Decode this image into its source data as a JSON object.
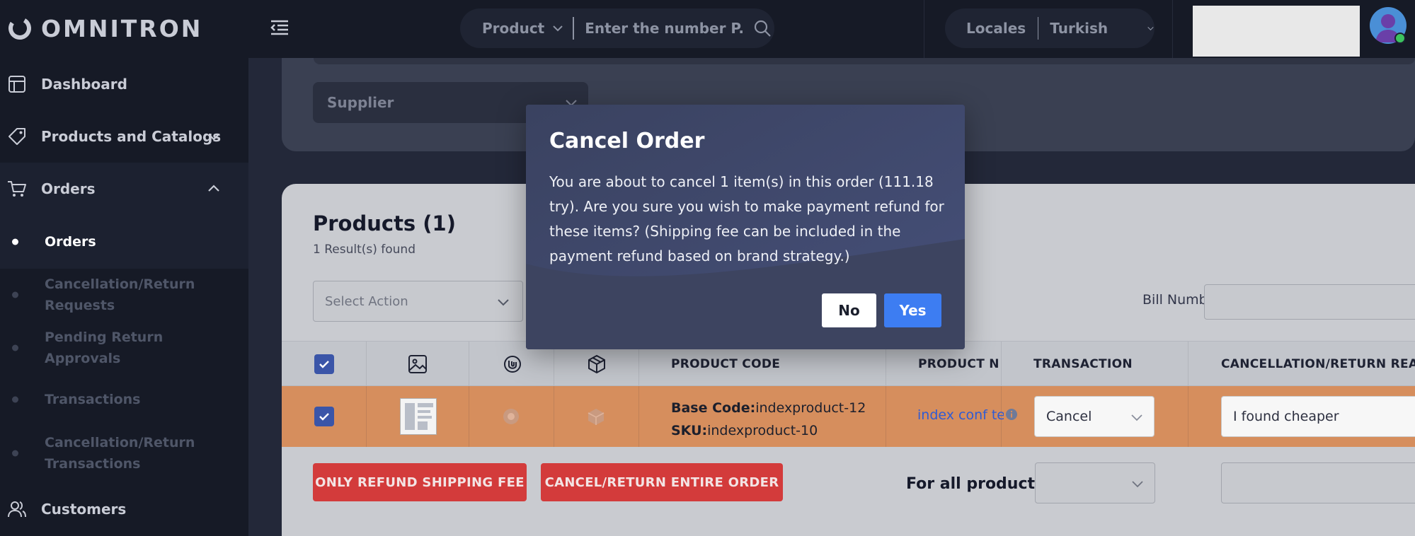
{
  "app": {
    "logo_text": "OMNITRON"
  },
  "sidebar": {
    "items": [
      {
        "label": "Dashboard",
        "icon": "layout-icon"
      },
      {
        "label": "Products and Catalogs",
        "icon": "tag-icon",
        "expanded": false
      },
      {
        "label": "Orders",
        "icon": "cart-icon",
        "expanded": true
      }
    ],
    "orders_sub": [
      {
        "label": "Orders",
        "active": true
      },
      {
        "label": "Cancellation/Return Requests",
        "active": false
      },
      {
        "label": "Pending Return Approvals",
        "active": false
      },
      {
        "label": "Transactions",
        "active": false
      },
      {
        "label": "Cancellation/Return Transactions",
        "active": false
      }
    ],
    "customers": {
      "label": "Customers",
      "icon": "users-icon"
    }
  },
  "topbar": {
    "search_type": "Product",
    "search_placeholder": "Enter the number P...",
    "locales_label": "Locales",
    "locale_value": "Turkish"
  },
  "filters": {
    "supplier_label": "Supplier"
  },
  "products": {
    "title": "Products (1)",
    "result_count": "1 Result(s) found",
    "select_action_placeholder": "Select Action",
    "bill_number_label": "Bill Number:",
    "columns": {
      "product_code": "PRODUCT CODE",
      "product_name": "PRODUCT NA",
      "transaction": "TRANSACTION",
      "reason": "CANCELLATION/RETURN REASO"
    },
    "row": {
      "checked": true,
      "base_code_label": "Base Code:",
      "base_code_value": "indexproduct-12",
      "sku_label": "SKU:",
      "sku_value": "indexproduct-10",
      "product_name": "index conf tes",
      "transaction": "Cancel",
      "reason": "I found cheaper"
    },
    "btn_refund_shipping": "ONLY REFUND SHIPPING FEE",
    "btn_cancel_entire": "CANCEL/RETURN ENTIRE ORDER",
    "for_all_label": "For all products"
  },
  "modal": {
    "title": "Cancel Order",
    "body": "You are about to cancel 1 item(s) in this order (111.18 try). Are you sure you wish to make payment refund for these items? (Shipping fee can be included in the payment refund based on brand strategy.)",
    "no_label": "No",
    "yes_label": "Yes"
  },
  "colors": {
    "sidebar_bg": "#161a26",
    "highlight_row": "#d68e5d",
    "danger": "#d33b3b",
    "primary": "#3d7df2",
    "modal_bg": "#3f4763"
  }
}
